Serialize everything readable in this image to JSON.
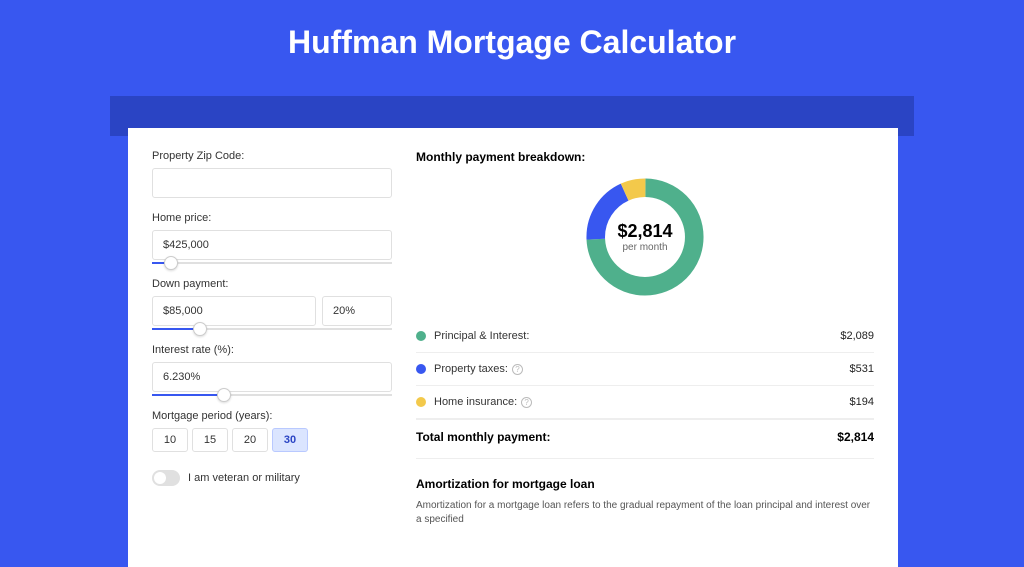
{
  "title": "Huffman Mortgage Calculator",
  "form": {
    "zip": {
      "label": "Property Zip Code:",
      "value": ""
    },
    "home_price": {
      "label": "Home price:",
      "value": "$425,000",
      "slider_pct": 8
    },
    "down_payment": {
      "label": "Down payment:",
      "value": "$85,000",
      "pct": "20%",
      "slider_pct": 20
    },
    "interest_rate": {
      "label": "Interest rate (%):",
      "value": "6.230%",
      "slider_pct": 30
    },
    "mortgage_period": {
      "label": "Mortgage period (years):",
      "options": [
        "10",
        "15",
        "20",
        "30"
      ],
      "selected": "30"
    },
    "veteran": {
      "label": "I am veteran or military",
      "checked": false
    }
  },
  "breakdown": {
    "heading": "Monthly payment breakdown:",
    "center_amount": "$2,814",
    "center_sub": "per month",
    "items": [
      {
        "label": "Principal & Interest:",
        "value": "$2,089",
        "color": "green",
        "info": false
      },
      {
        "label": "Property taxes:",
        "value": "$531",
        "color": "blue",
        "info": true
      },
      {
        "label": "Home insurance:",
        "value": "$194",
        "color": "yellow",
        "info": true
      }
    ],
    "total_label": "Total monthly payment:",
    "total_value": "$2,814"
  },
  "amortization": {
    "title": "Amortization for mortgage loan",
    "text": "Amortization for a mortgage loan refers to the gradual repayment of the loan principal and interest over a specified"
  },
  "chart_data": {
    "type": "pie",
    "title": "Monthly payment breakdown",
    "series": [
      {
        "name": "Principal & Interest",
        "value": 2089,
        "color": "#4fb08c"
      },
      {
        "name": "Property taxes",
        "value": 531,
        "color": "#3857f0"
      },
      {
        "name": "Home insurance",
        "value": 194,
        "color": "#f3c94b"
      }
    ],
    "total": 2814
  }
}
